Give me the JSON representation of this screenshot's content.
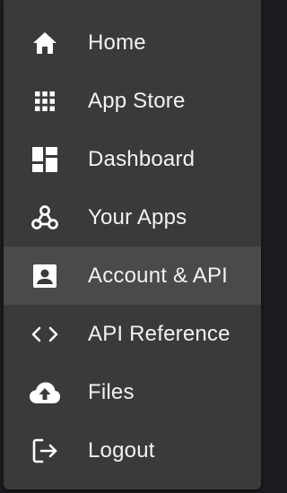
{
  "menu": {
    "items": [
      {
        "label": "Home",
        "icon": "home-icon"
      },
      {
        "label": "App Store",
        "icon": "grid-icon"
      },
      {
        "label": "Dashboard",
        "icon": "dashboard-icon"
      },
      {
        "label": "Your Apps",
        "icon": "webhook-icon"
      },
      {
        "label": "Account & API",
        "icon": "account-box-icon",
        "active": true
      },
      {
        "label": "API Reference",
        "icon": "code-icon"
      },
      {
        "label": "Files",
        "icon": "cloud-upload-icon"
      },
      {
        "label": "Logout",
        "icon": "logout-icon"
      }
    ]
  },
  "colors": {
    "menu_background": "#3a3a3a",
    "active_background": "#4a4a4a",
    "text": "#f2f2f2",
    "icon": "#ffffff"
  }
}
